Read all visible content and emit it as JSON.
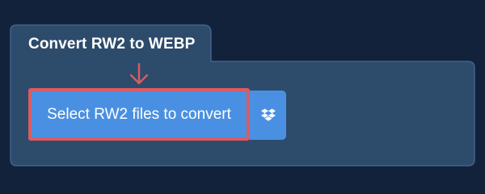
{
  "converter": {
    "tab_title": "Convert RW2 to WEBP",
    "select_button_label": "Select RW2 files to convert"
  },
  "icons": {
    "pointer_arrow": "arrow-down-icon",
    "cloud_source": "dropbox-icon"
  },
  "colors": {
    "page_background": "#11223a",
    "panel_background": "#2d4b6b",
    "panel_border": "#41638a",
    "button_background": "#4a90e2",
    "highlight_border": "#d95c62",
    "text": "#ffffff"
  }
}
